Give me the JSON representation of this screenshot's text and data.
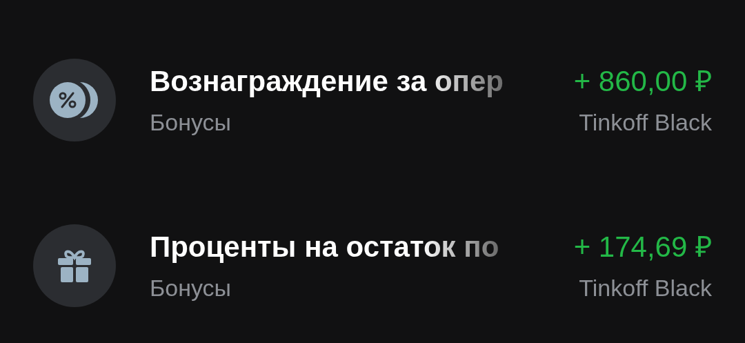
{
  "operations": [
    {
      "kind": "percent",
      "title": "Вознаграждение за опер",
      "category": "Бонусы",
      "amount": "+ 860,00 ₽",
      "account": "Tinkoff Black"
    },
    {
      "kind": "gift",
      "title": "Проценты на остаток по",
      "category": "Бонусы",
      "amount": "+ 174,69 ₽",
      "account": "Tinkoff Black"
    }
  ]
}
